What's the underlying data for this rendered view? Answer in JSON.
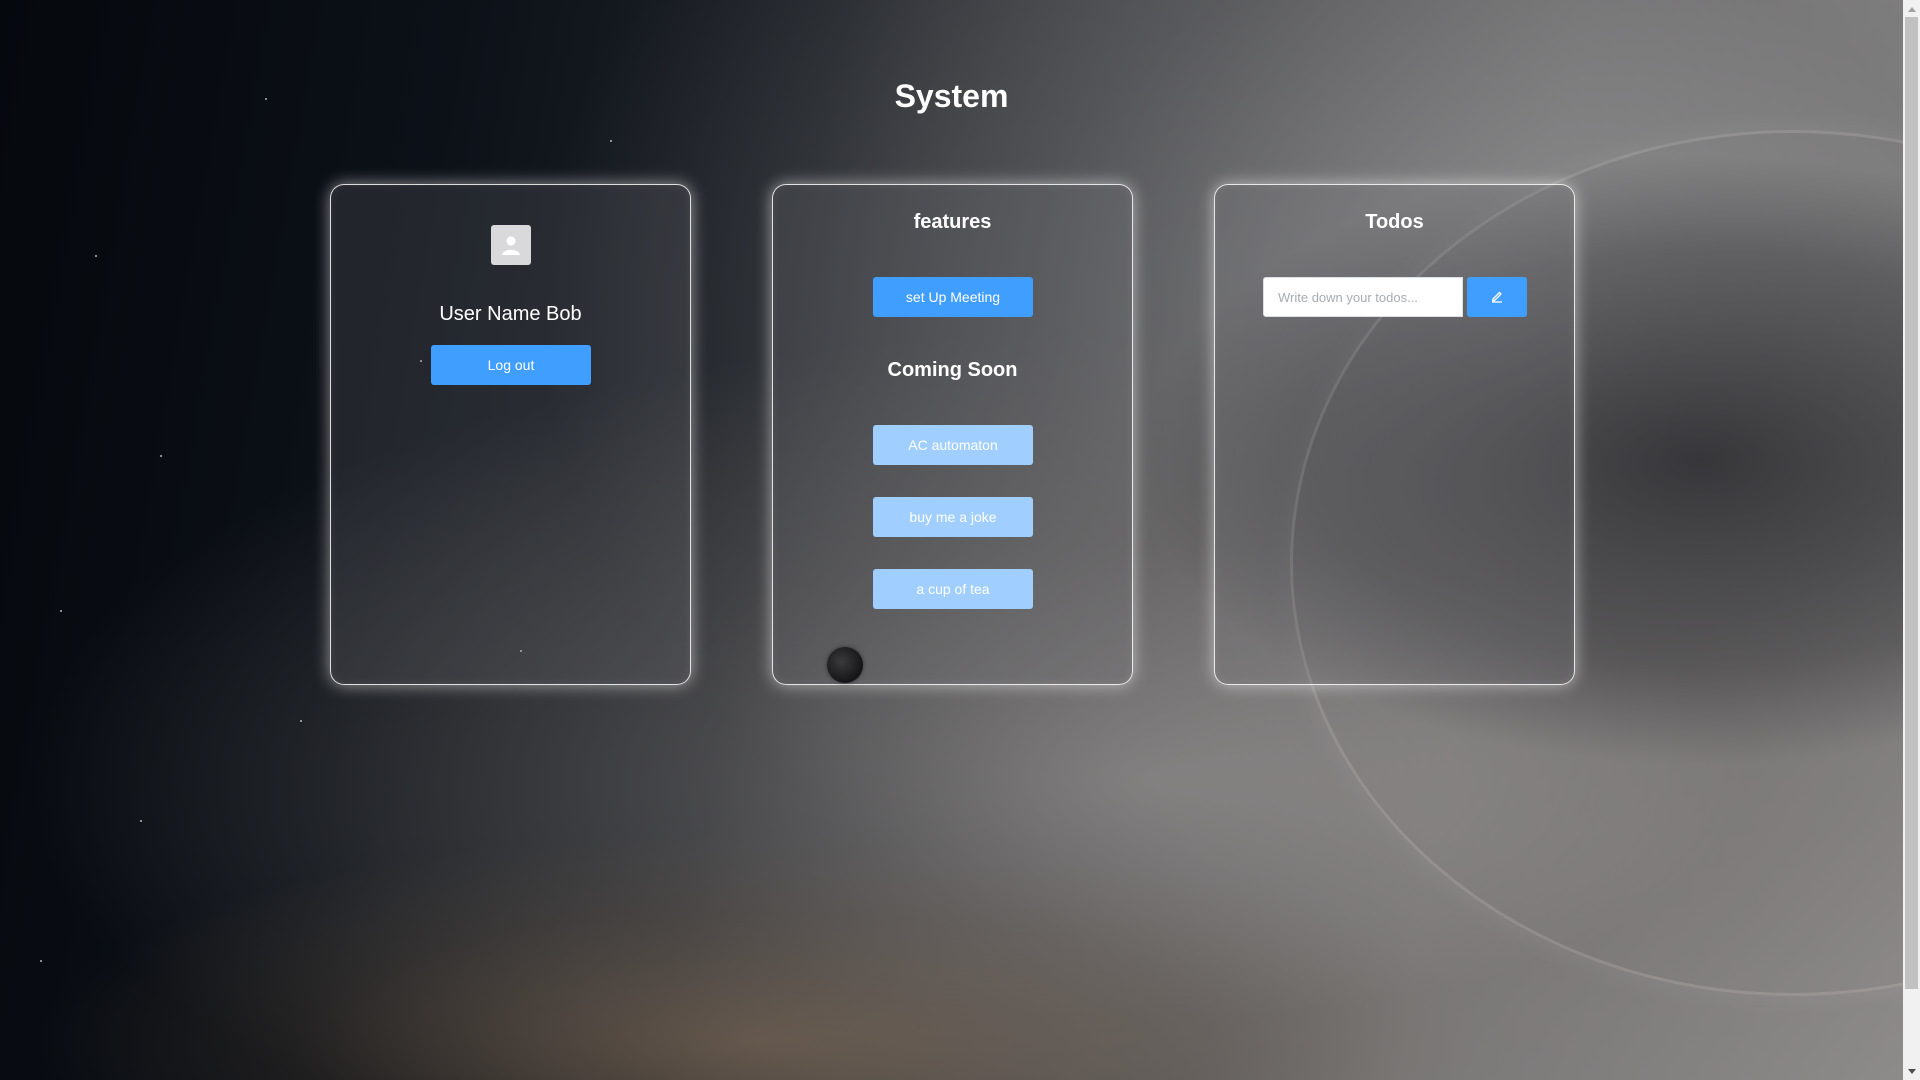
{
  "page": {
    "title": "System"
  },
  "user_card": {
    "avatar_icon": "user-avatar-icon",
    "user_name": "User Name Bob",
    "logout_label": "Log out"
  },
  "features_card": {
    "heading": "features",
    "meeting_label": "set Up Meeting",
    "coming_soon_heading": "Coming Soon",
    "coming_soon_items": [
      {
        "label": "AC automaton"
      },
      {
        "label": "buy me a joke"
      },
      {
        "label": "a cup of tea"
      }
    ]
  },
  "todos_card": {
    "heading": "Todos",
    "input_value": "",
    "input_placeholder": "Write down your todos...",
    "submit_icon": "pencil-icon"
  },
  "colors": {
    "primary": "#409eff",
    "disabled": "#a0cfff",
    "card_border": "#ffffff",
    "text": "#ffffff"
  }
}
